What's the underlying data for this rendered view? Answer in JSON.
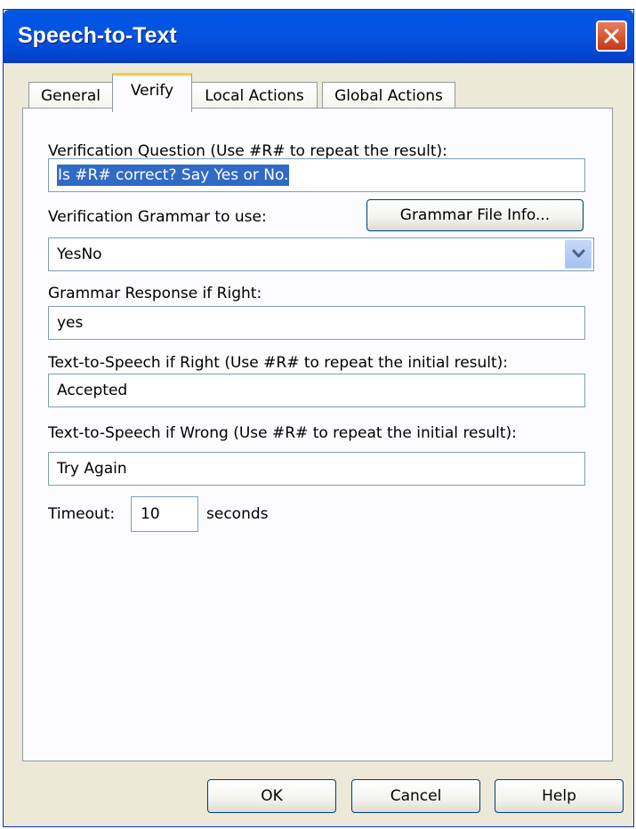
{
  "window": {
    "title": "Speech-to-Text"
  },
  "tabs": [
    {
      "label": "General"
    },
    {
      "label": "Verify"
    },
    {
      "label": "Local Actions"
    },
    {
      "label": "Global Actions"
    }
  ],
  "verify": {
    "question_label": "Verification Question (Use #R# to repeat the result):",
    "question_value": "Is #R# correct?  Say Yes or No.",
    "grammar_label": "Verification Grammar to use:",
    "grammar_info_button": "Grammar File Info...",
    "grammar_value": "YesNo",
    "response_label": "Grammar Response if Right:",
    "response_value": "yes",
    "tts_right_label": "Text-to-Speech if Right (Use #R# to repeat the initial result):",
    "tts_right_value": "Accepted",
    "tts_wrong_label": "Text-to-Speech if Wrong (Use #R# to repeat the initial result):",
    "tts_wrong_value": "Try Again",
    "timeout_label": "Timeout:",
    "timeout_value": "10",
    "timeout_unit": "seconds"
  },
  "buttons": {
    "ok": "OK",
    "cancel": "Cancel",
    "help": "Help"
  },
  "colors": {
    "titlebar": "#0553e0",
    "active_tab_accent": "#ffc83c",
    "selection": "#316ac5",
    "close": "#d8512f"
  }
}
